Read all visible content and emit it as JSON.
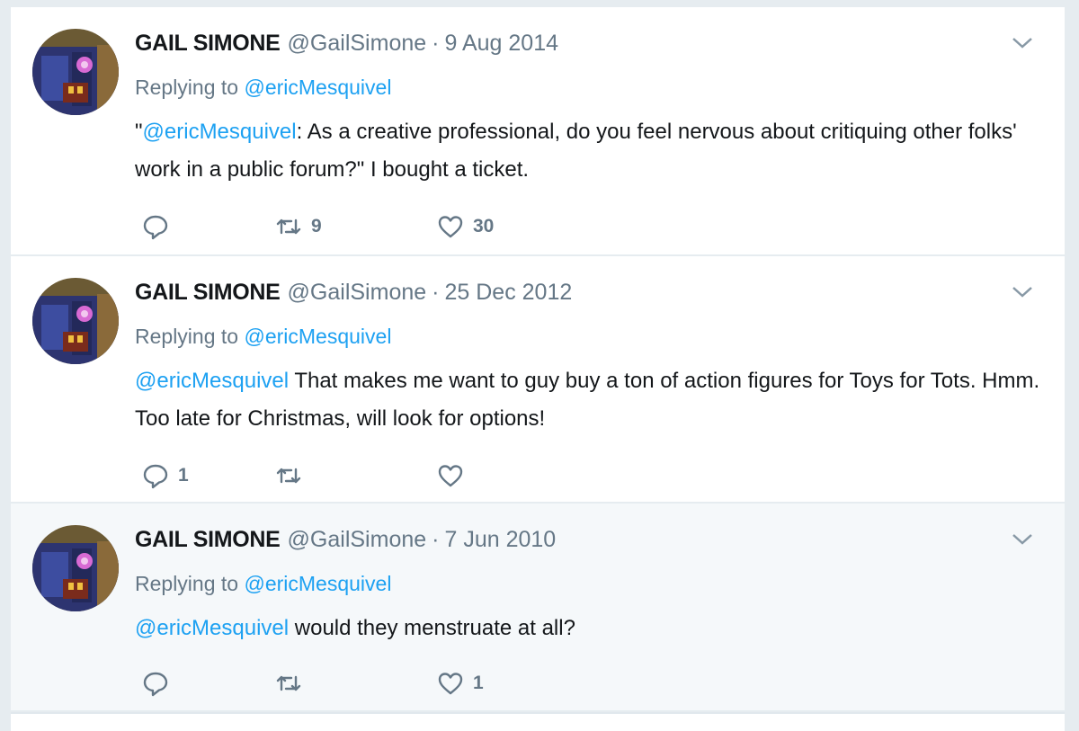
{
  "tweets": [
    {
      "name": "GAIL SIMONE",
      "handle": "@GailSimone",
      "separator": "·",
      "date": "9 Aug 2014",
      "replying_prefix": "Replying to",
      "replying_to": "@ericMesquivel",
      "text_prefix": "\"",
      "text_mention": "@ericMesquivel",
      "text_rest": ": As a creative professional, do you feel nervous about critiquing other folks' work in a public forum?\" I bought a ticket.",
      "reply_count": "",
      "retweet_count": "9",
      "like_count": "30"
    },
    {
      "name": "GAIL SIMONE",
      "handle": "@GailSimone",
      "separator": "·",
      "date": "25 Dec 2012",
      "replying_prefix": "Replying to",
      "replying_to": "@ericMesquivel",
      "text_prefix": "",
      "text_mention": "@ericMesquivel",
      "text_rest": " That makes me want to guy buy a ton of action figures for Toys for Tots. Hmm. Too late for Christmas, will look for options!",
      "reply_count": "1",
      "retweet_count": "",
      "like_count": ""
    },
    {
      "name": "GAIL SIMONE",
      "handle": "@GailSimone",
      "separator": "·",
      "date": "7 Jun 2010",
      "replying_prefix": "Replying to",
      "replying_to": "@ericMesquivel",
      "text_prefix": "",
      "text_mention": "@ericMesquivel",
      "text_rest": " would they menstruate at all?",
      "reply_count": "",
      "retweet_count": "",
      "like_count": "1"
    }
  ],
  "icons": {
    "reply": "reply-icon",
    "retweet": "retweet-icon",
    "like": "heart-icon",
    "more": "chevron-down-icon",
    "avatar": "avatar"
  },
  "colors": {
    "link": "#1da1f2",
    "muted": "#657786",
    "background": "#e6ecf0",
    "highlight_row": "#f5f8fa"
  }
}
